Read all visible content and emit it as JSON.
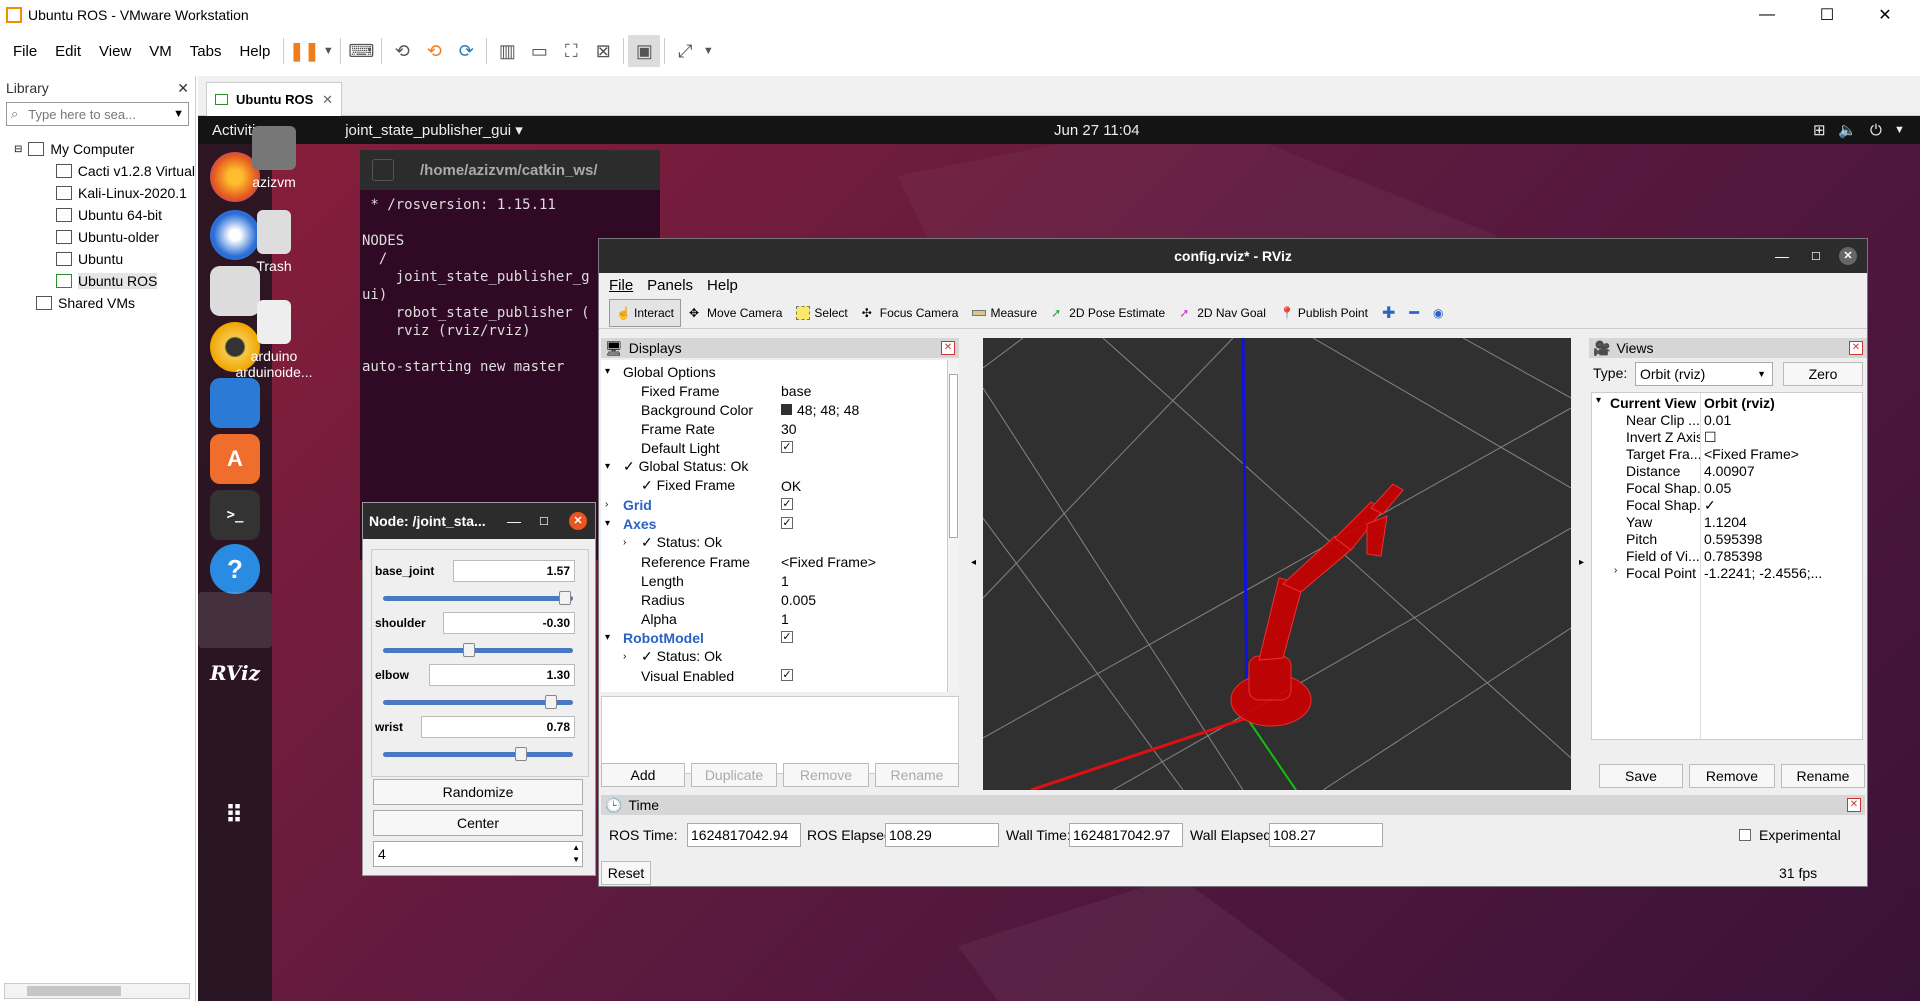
{
  "window": {
    "title": "Ubuntu ROS - VMware Workstation",
    "min": "—",
    "max": "☐",
    "close": "✕"
  },
  "vm_menu": [
    "File",
    "Edit",
    "View",
    "VM",
    "Tabs",
    "Help"
  ],
  "library": {
    "title": "Library",
    "close": "✕",
    "search_placeholder": "Type here to sea...",
    "tree": {
      "root": "My Computer",
      "vms": [
        "Cacti v1.2.8 Virtual",
        "Kali-Linux-2020.1",
        "Ubuntu 64-bit",
        "Ubuntu-older",
        "Ubuntu",
        "Ubuntu ROS"
      ],
      "shared": "Shared VMs"
    }
  },
  "vm_tab": {
    "label": "Ubuntu ROS",
    "close": "✕"
  },
  "gnome": {
    "activities": "Activities",
    "app": "joint_state_publisher_gui ▾",
    "clock": "Jun 27  11:04"
  },
  "desktop": {
    "home": "azizvm",
    "trash": "Trash",
    "arduino1": "arduino",
    "arduino2": "arduinoide..."
  },
  "dock": {
    "rviz": "RViz"
  },
  "terminal": {
    "title": "/home/azizvm/catkin_ws/",
    "lines": [
      " * /rosversion: 1.15.11",
      "",
      "NODES",
      "  /",
      "    joint_state_publisher_g",
      "ui)",
      "    robot_state_publisher (",
      "    rviz (rviz/rviz)",
      "",
      "auto-starting new master"
    ]
  },
  "joint_gui": {
    "title": "Node: /joint_sta...",
    "min": "—",
    "max": "☐",
    "close": "✕",
    "joints": [
      {
        "name": "base_joint",
        "value": "1.57",
        "frac": 0.99
      },
      {
        "name": "shoulder",
        "value": "-0.30",
        "frac": 0.45
      },
      {
        "name": "elbow",
        "value": "1.30",
        "frac": 0.91
      },
      {
        "name": "wrist",
        "value": "0.78",
        "frac": 0.74
      }
    ],
    "randomize": "Randomize",
    "center": "Center",
    "spin": "4"
  },
  "rviz": {
    "title": "config.rviz* - RViz",
    "min": "—",
    "max": "☐",
    "close": "✕",
    "menu": [
      "File",
      "Panels",
      "Help"
    ],
    "tools": [
      "Interact",
      "Move Camera",
      "Select",
      "Focus Camera",
      "Measure",
      "2D Pose Estimate",
      "2D Nav Goal",
      "Publish Point"
    ],
    "displays": {
      "title": "Displays",
      "rows": [
        {
          "label": "Global Options",
          "value": "",
          "indent": 1,
          "exp": "▾",
          "color": "#000",
          "bold": false
        },
        {
          "label": "Fixed Frame",
          "value": "base",
          "indent": 2
        },
        {
          "label": "Background Color",
          "value": "48; 48; 48",
          "indent": 2
        },
        {
          "label": "Frame Rate",
          "value": "30",
          "indent": 2
        },
        {
          "label": "Default Light",
          "value": "✓",
          "indent": 2
        },
        {
          "label": "✓ Global Status: Ok",
          "value": "",
          "indent": 1,
          "exp": "▾"
        },
        {
          "label": "✓ Fixed Frame",
          "value": "OK",
          "indent": 2
        },
        {
          "label": "Grid",
          "value": "✓",
          "indent": 1,
          "exp": "›",
          "color": "#2a62c6",
          "bold": true
        },
        {
          "label": "Axes",
          "value": "✓",
          "indent": 1,
          "exp": "▾",
          "color": "#2a62c6",
          "bold": true
        },
        {
          "label": "✓ Status: Ok",
          "value": "",
          "indent": 2,
          "exp": "›"
        },
        {
          "label": "Reference Frame",
          "value": "<Fixed Frame>",
          "indent": 2
        },
        {
          "label": "Length",
          "value": "1",
          "indent": 2
        },
        {
          "label": "Radius",
          "value": "0.005",
          "indent": 2
        },
        {
          "label": "Alpha",
          "value": "1",
          "indent": 2
        },
        {
          "label": "RobotModel",
          "value": "✓",
          "indent": 1,
          "exp": "▾",
          "color": "#2a62c6",
          "bold": true
        },
        {
          "label": "✓ Status: Ok",
          "value": "",
          "indent": 2,
          "exp": "›"
        },
        {
          "label": "Visual Enabled",
          "value": "✓",
          "indent": 2
        }
      ],
      "buttons": [
        "Add",
        "Duplicate",
        "Remove",
        "Rename"
      ]
    },
    "views": {
      "title": "Views",
      "type_label": "Type:",
      "type_value": "Orbit (rviz)",
      "zero": "Zero",
      "rows": [
        {
          "label": "Current View",
          "value": "Orbit (rviz)",
          "bold": true
        },
        {
          "label": "Near Clip ...",
          "value": "0.01"
        },
        {
          "label": "Invert Z Axis",
          "value": "☐"
        },
        {
          "label": "Target Fra...",
          "value": "<Fixed Frame>"
        },
        {
          "label": "Distance",
          "value": "4.00907"
        },
        {
          "label": "Focal Shap...",
          "value": "0.05"
        },
        {
          "label": "Focal Shap...",
          "value": "✓"
        },
        {
          "label": "Yaw",
          "value": "1.1204"
        },
        {
          "label": "Pitch",
          "value": "0.595398"
        },
        {
          "label": "Field of Vi...",
          "value": "0.785398"
        },
        {
          "label": "Focal Point",
          "value": "-1.2241; -2.4556;..."
        }
      ],
      "buttons": [
        "Save",
        "Remove",
        "Rename"
      ]
    },
    "time": {
      "title": "Time",
      "ros_time_label": "ROS Time:",
      "ros_time": "1624817042.94",
      "ros_elapsed_label": "ROS Elapsed:",
      "ros_elapsed": "108.29",
      "wall_time_label": "Wall Time:",
      "wall_time": "1624817042.97",
      "wall_elapsed_label": "Wall Elapsed:",
      "wall_elapsed": "108.27",
      "experimental": "Experimental",
      "reset": "Reset",
      "fps": "31 fps"
    }
  }
}
